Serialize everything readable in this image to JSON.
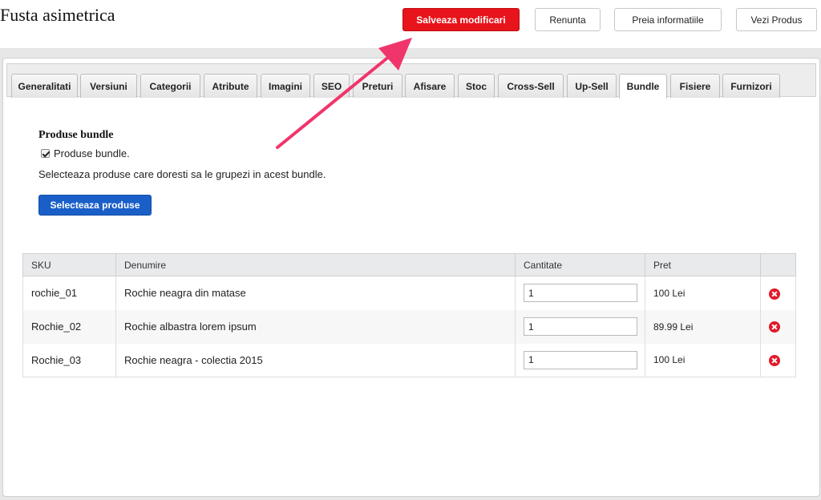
{
  "header": {
    "title": "Fusta asimetrica",
    "buttons": {
      "save": "Salveaza modificari",
      "cancel": "Renunta",
      "fetch": "Preia informatiile",
      "view": "Vezi Produs"
    }
  },
  "tabs": [
    {
      "label": "Generalitati"
    },
    {
      "label": "Versiuni"
    },
    {
      "label": "Categorii"
    },
    {
      "label": "Atribute"
    },
    {
      "label": "Imagini"
    },
    {
      "label": "SEO"
    },
    {
      "label": "Preturi"
    },
    {
      "label": "Afisare"
    },
    {
      "label": "Stoc"
    },
    {
      "label": "Cross-Sell"
    },
    {
      "label": "Up-Sell"
    },
    {
      "label": "Bundle",
      "active": true
    },
    {
      "label": "Fisiere"
    },
    {
      "label": "Furnizori"
    }
  ],
  "bundle": {
    "heading": "Produse bundle",
    "checkbox_label": "Produse bundle.",
    "checkbox_checked": true,
    "instruction": "Selecteaza produse care doresti sa le grupezi in acest bundle.",
    "select_button": "Selecteaza produse",
    "table": {
      "columns": [
        "SKU",
        "Denumire",
        "Cantitate",
        "Pret"
      ],
      "rows": [
        {
          "sku": "rochie_01",
          "name": "Rochie neagra din matase",
          "qty": "1",
          "price": "100 Lei"
        },
        {
          "sku": "Rochie_02",
          "name": "Rochie albastra lorem ipsum",
          "qty": "1",
          "price": "89.99 Lei"
        },
        {
          "sku": "Rochie_03",
          "name": "Rochie neagra - colectia 2015",
          "qty": "1",
          "price": "100 Lei"
        }
      ]
    }
  },
  "colors": {
    "save_button": "#e8141b",
    "select_button": "#1a5fc8",
    "annotation_arrow": "#f0356b",
    "remove_icon": "#e0192a"
  },
  "icons": {
    "remove": "close-circle-icon",
    "annotation": "arrow-icon"
  }
}
